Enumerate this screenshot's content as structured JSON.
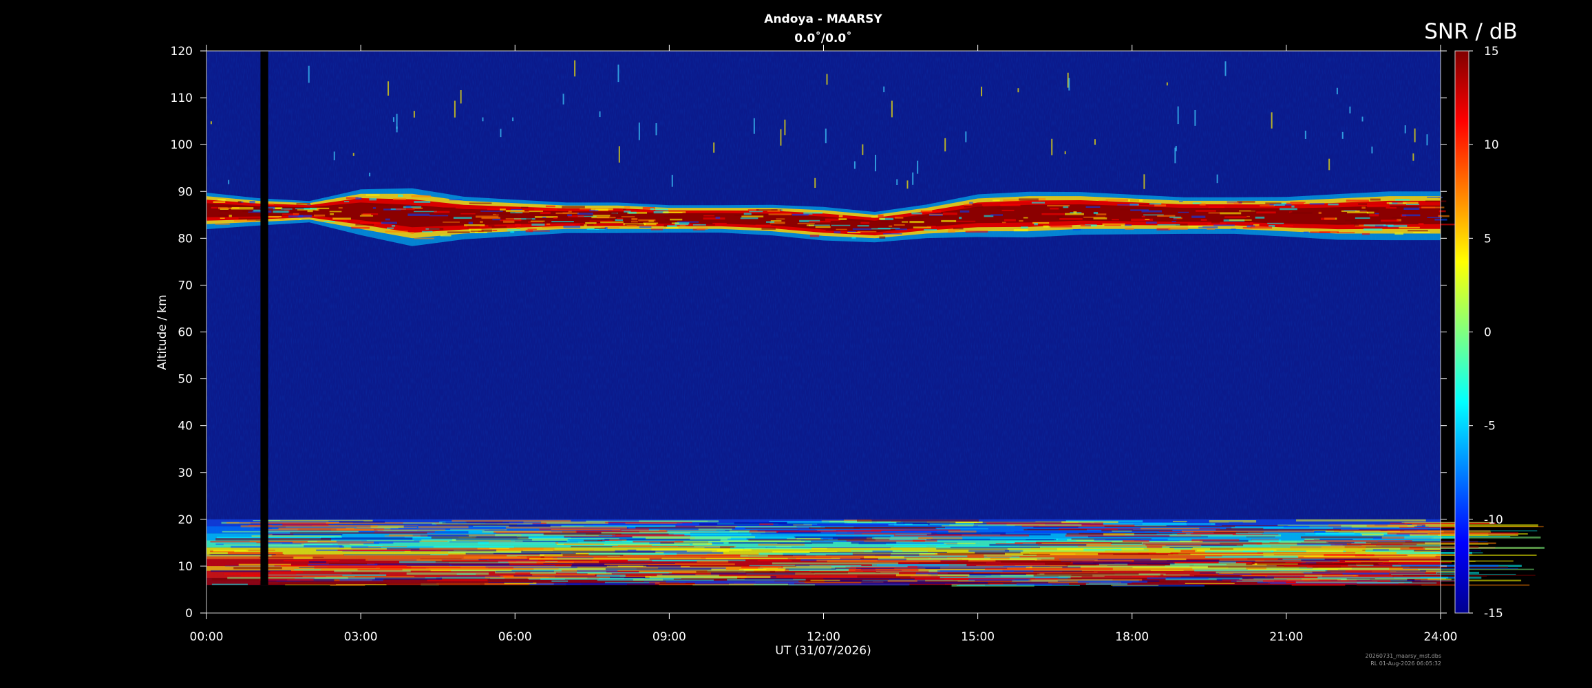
{
  "chart_data": {
    "type": "heatmap",
    "title": "Andoya - MAARSY",
    "subtitle": "0.0˚/0.0˚",
    "xlabel": "UT (31/07/2026)",
    "ylabel": "Altitude / km",
    "x_ticks": [
      "00:00",
      "03:00",
      "06:00",
      "09:00",
      "12:00",
      "15:00",
      "18:00",
      "21:00",
      "24:00"
    ],
    "xlim_hours": [
      0,
      24
    ],
    "y_ticks": [
      0,
      10,
      20,
      30,
      40,
      50,
      60,
      70,
      80,
      90,
      100,
      110,
      120
    ],
    "ylim": [
      0,
      120
    ],
    "colorbar": {
      "label": "SNR / dB",
      "range": [
        -15,
        15
      ],
      "ticks": [
        -15,
        -10,
        -5,
        0,
        5,
        10,
        15
      ],
      "colormap": "jet"
    },
    "background_color": "#0b1a8c",
    "data_gap": {
      "start_hour": 1.05,
      "end_hour": 1.2
    },
    "data_min_altitude_km": 6,
    "echo_layers": [
      {
        "name": "mesospheric echo layer (PMSE)",
        "bottom_km": [
          83,
          83.5,
          84,
          82,
          80,
          81,
          81.5,
          82,
          82,
          82,
          82,
          81.5,
          80.5,
          80,
          81,
          81.5,
          81.5,
          82,
          82,
          82,
          82,
          81.5,
          81,
          81,
          81
        ],
        "top_km": [
          89,
          88,
          87.5,
          89.5,
          89.5,
          88,
          87.5,
          87,
          87,
          86.5,
          86.5,
          86.5,
          86,
          85,
          86.5,
          88.5,
          89,
          89,
          88.5,
          88,
          88,
          88,
          88.5,
          89,
          89
        ]
      },
      {
        "name": "tropospheric echoes",
        "bottom_km": 6,
        "top_km": 20
      }
    ],
    "footer": [
      "20260731_maarsy_mst.dbs",
      "RL 01-Aug-2026 06:05:32"
    ]
  }
}
